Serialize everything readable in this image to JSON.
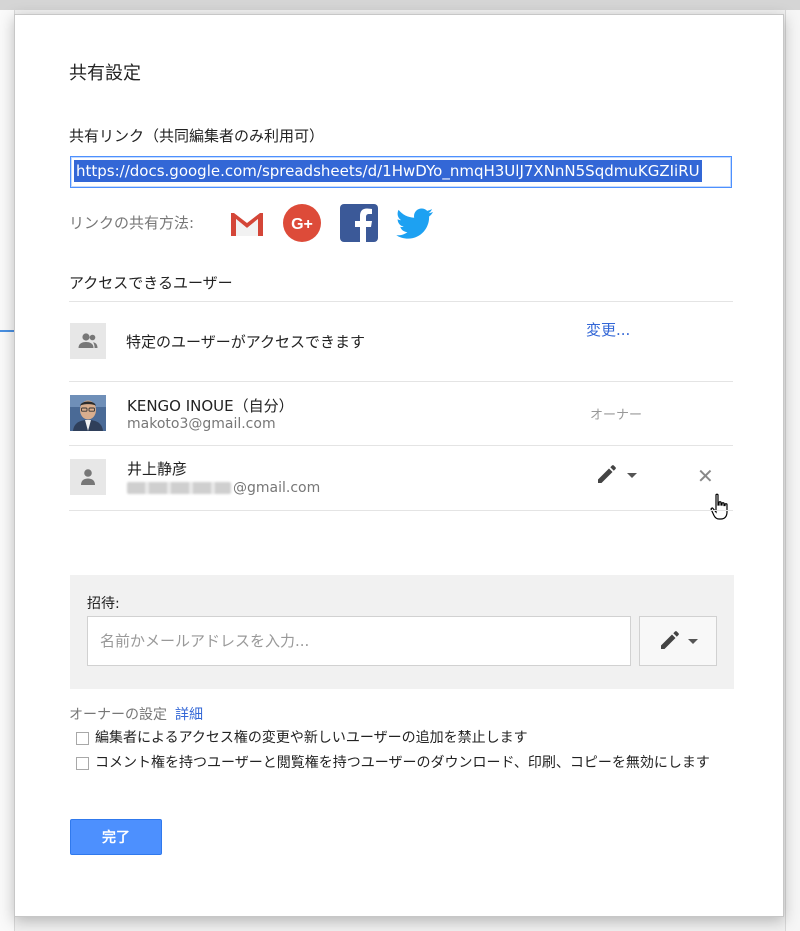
{
  "dialog": {
    "title": "共有設定",
    "link_section_label": "共有リンク（共同編集者のみ利用可）",
    "share_link": "https://docs.google.com/spreadsheets/d/1HwDYo_nmqH3UlJ7XNnN5SqdmuKGZIiRU",
    "share_via_label": "リンクの共有方法:",
    "share_icons": [
      "gmail-icon",
      "google-plus-icon",
      "facebook-icon",
      "twitter-icon"
    ],
    "access_section_label": "アクセスできるユーザー",
    "access_setting": {
      "text": "特定のユーザーがアクセスできます",
      "change_label": "変更..."
    },
    "users": [
      {
        "name": "KENGO INOUE（自分）",
        "email": "makoto3@gmail.com",
        "role": "オーナー"
      },
      {
        "name": "井上静彦",
        "email_suffix": "@gmail.com"
      }
    ],
    "invite": {
      "label": "招待:",
      "placeholder": "名前かメールアドレスを入力..."
    },
    "owner_settings": {
      "label": "オーナーの設定",
      "details_link": "詳細",
      "options": [
        "編集者によるアクセス権の変更や新しいユーザーの追加を禁止します",
        "コメント権を持つユーザーと閲覧権を持つユーザーのダウンロード、印刷、コピーを無効にします"
      ]
    },
    "done_label": "完了"
  },
  "colors": {
    "accent_blue": "#4d90fe",
    "link_blue": "#3367d6",
    "gmail_red": "#d44638",
    "gplus_red": "#dd4b39",
    "facebook_blue": "#3b5998",
    "twitter_blue": "#1da1f2"
  }
}
